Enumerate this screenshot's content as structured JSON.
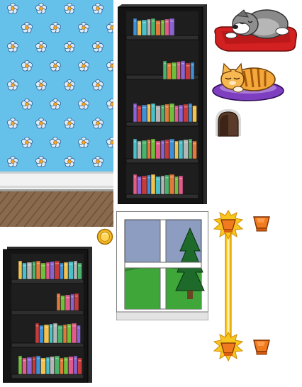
{
  "sheet": {
    "colors": {
      "wallpaper_bg": "#66c1ea",
      "flower_petal": "#dcecff",
      "flower_center": "#f5a623",
      "baseboard": "#f2f2f2",
      "floor_wood": "#8a6a4f",
      "shelf_frame": "#141414",
      "window_frame": "#ffffff",
      "sky": "#8d9cc1",
      "grass": "#3fa63a",
      "tree": "#1e6a2a",
      "dog_bed": "#d32020",
      "cat_bed": "#7d3fbf",
      "lamp_glow": "#f7c51e",
      "lamp_shade": "#f07a1e",
      "coin": "#f3b82a"
    },
    "sprites": [
      {
        "name": "wallpaper-tile",
        "icon": "flower-wallpaper"
      },
      {
        "name": "baseboard-tile",
        "icon": "baseboard"
      },
      {
        "name": "floor-tile",
        "icon": "wood-floor"
      },
      {
        "name": "bookshelf-large",
        "icon": "bookshelf"
      },
      {
        "name": "bookshelf-small",
        "icon": "bookshelf"
      },
      {
        "name": "sleeping-dog-on-bed",
        "icon": "dog"
      },
      {
        "name": "sleeping-cat-on-bed",
        "icon": "cat"
      },
      {
        "name": "mouse-hole",
        "icon": "mouse-hole"
      },
      {
        "name": "window",
        "icon": "window"
      },
      {
        "name": "gold-coin",
        "icon": "coin"
      },
      {
        "name": "wall-lamp-lit",
        "icon": "lamp-on"
      },
      {
        "name": "wall-lamp-unlit",
        "icon": "lamp-off"
      }
    ]
  }
}
